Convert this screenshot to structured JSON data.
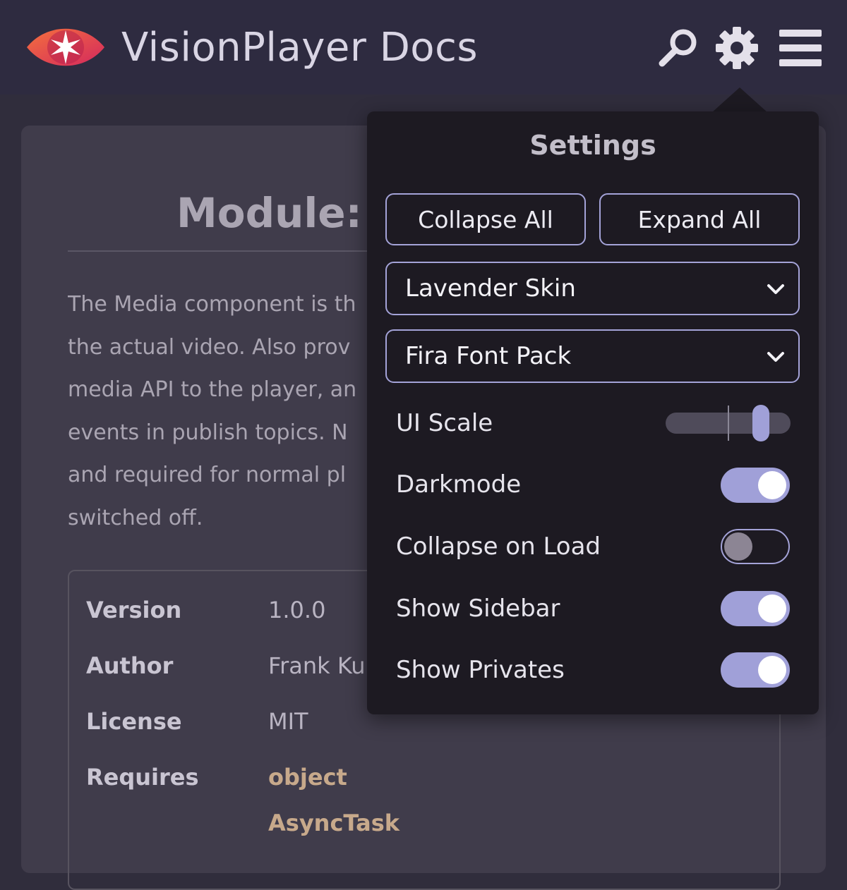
{
  "header": {
    "app_title": "VisionPlayer Docs",
    "icons": [
      "eye-star-logo-icon",
      "search-icon",
      "gear-icon",
      "hamburger-menu-icon"
    ]
  },
  "document": {
    "module_title": "Module: s",
    "description_lines": [
      "The Media component is th",
      "the actual video. Also prov",
      "media API to the player, an",
      "events in publish topics. N",
      "and required for normal pl",
      "switched off."
    ],
    "meta": [
      {
        "key": "Version",
        "value": "1.0.0"
      },
      {
        "key": "Author",
        "value": "Frank Ku"
      },
      {
        "key": "License",
        "value": "MIT"
      },
      {
        "key": "Requires",
        "value": "object"
      }
    ],
    "requires_extra": "AsyncTask"
  },
  "settings": {
    "title": "Settings",
    "collapse_all": "Collapse All",
    "expand_all": "Expand All",
    "skin_select": "Lavender Skin",
    "font_select": "Fira Font Pack",
    "ui_scale": {
      "label": "UI Scale",
      "value_fraction": 0.76,
      "default_fraction": 0.5
    },
    "toggles": [
      {
        "label": "Darkmode",
        "on": true
      },
      {
        "label": "Collapse on Load",
        "on": false
      },
      {
        "label": "Show Sidebar",
        "on": true
      },
      {
        "label": "Show Privates",
        "on": true
      }
    ]
  },
  "colors": {
    "accent": "#a0a0d8",
    "link": "#c7a98b",
    "header_bg": "#2e2b40",
    "panel_bg": "#1d1a22"
  }
}
